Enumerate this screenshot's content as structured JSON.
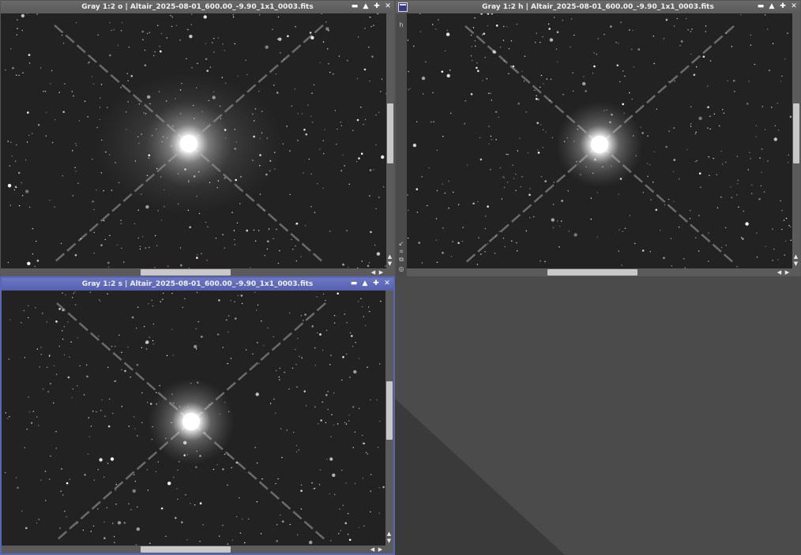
{
  "windows": [
    {
      "id": "o",
      "title": "Gray 1:2 o | Altair_2025-08-01_600.00_-9.90_1x1_0003.fits",
      "active": false,
      "mask_tag": ""
    },
    {
      "id": "h",
      "title": "Gray 1:2 h | Altair_2025-08-01_600.00_-9.90_1x1_0003.fits",
      "active": false,
      "mask_tag": "h"
    },
    {
      "id": "s",
      "title": "Gray 1:2 s | Altair_2025-08-01_600.00_-9.90_1x1_0003.fits",
      "active": true,
      "mask_tag": ""
    }
  ],
  "window_buttons": {
    "minimize": "▬",
    "shade": "▲",
    "maximize": "✚",
    "close": "✕"
  },
  "scroll_arrows": {
    "up": "▲",
    "down": "▼",
    "left": "◀",
    "right": "▶"
  },
  "side_tabs": {
    "t1": "↙",
    "t2": "⌗",
    "t3": "⧉",
    "t4": "◎"
  },
  "icons": [
    "workspace-window-icon",
    "minimize-icon",
    "shade-icon",
    "maximize-icon",
    "close-icon",
    "star-image"
  ],
  "colors": {
    "active_frame": "#5a67b7",
    "inactive_frame": "#626262",
    "workspace": "#444444"
  }
}
